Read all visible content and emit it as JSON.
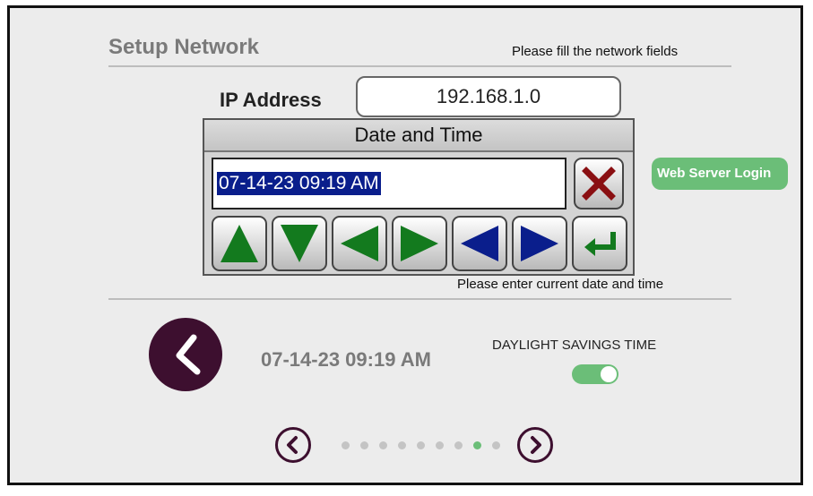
{
  "header": {
    "title": "Setup Network",
    "hint": "Please fill the network fields"
  },
  "ip": {
    "label": "IP Address",
    "value": "192.168.1.0"
  },
  "web_server": {
    "label": "Web Server Login"
  },
  "dialog": {
    "title": "Date and Time",
    "input_value": "07-14-23 09:19 AM",
    "clear_icon": "x-icon",
    "buttons": [
      {
        "icon": "triangle-up-icon",
        "color": "#137a1e"
      },
      {
        "icon": "triangle-down-icon",
        "color": "#137a1e"
      },
      {
        "icon": "triangle-left-icon",
        "color": "#137a1e"
      },
      {
        "icon": "triangle-right-icon",
        "color": "#137a1e"
      },
      {
        "icon": "triangle-left-icon",
        "color": "#0a1e8c"
      },
      {
        "icon": "triangle-right-icon",
        "color": "#0a1e8c"
      },
      {
        "icon": "enter-icon",
        "color": "#137a1e"
      }
    ],
    "hint": "Please enter current date and time"
  },
  "clock": {
    "icon": "clock-icon",
    "time": "07-14-23 09:19 AM"
  },
  "dst": {
    "label": "DAYLIGHT SAVINGS TIME",
    "enabled": true
  },
  "pager": {
    "prev_icon": "chevron-left-icon",
    "next_icon": "chevron-right-icon",
    "page_count": 9,
    "active_page": 8
  },
  "colors": {
    "accent_green": "#6bbe78",
    "brand_purple": "#3d0f2f",
    "selection_blue": "#0a1e8c"
  }
}
